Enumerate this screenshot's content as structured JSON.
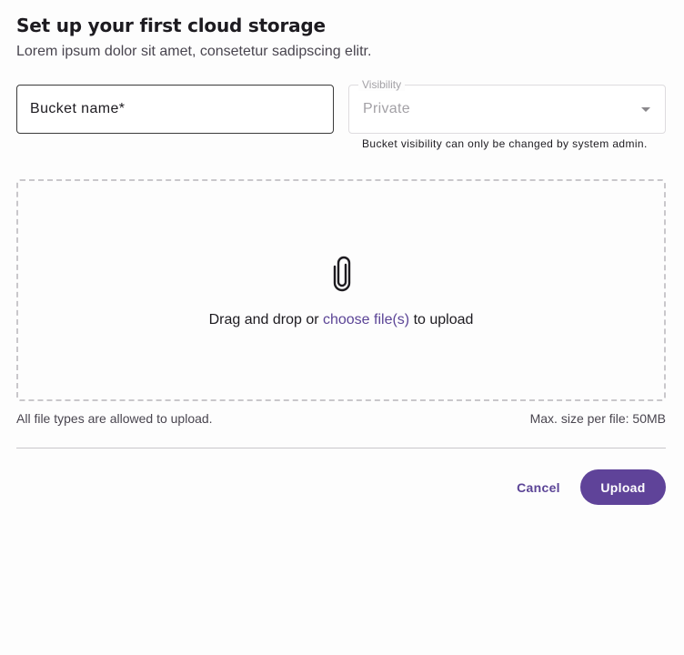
{
  "header": {
    "title": "Set up your first cloud storage",
    "subtitle": "Lorem ipsum dolor sit amet, consetetur sadipscing elitr."
  },
  "bucket_field": {
    "placeholder": "Bucket name*",
    "value": ""
  },
  "visibility": {
    "label": "Visibility",
    "selected": "Private",
    "helper": "Bucket visibility can only be changed by system admin.",
    "icon": "dropdown-arrow-icon"
  },
  "dropzone": {
    "icon": "paperclip-icon",
    "text_before": "Drag and drop or ",
    "link_text": "choose file(s)",
    "text_after": " to upload",
    "hint_left": "All file types are allowed to upload.",
    "hint_right": "Max. size per file: 50MB"
  },
  "actions": {
    "cancel_label": "Cancel",
    "upload_label": "Upload"
  },
  "colors": {
    "accent": "#5f4399",
    "link": "#5b4496",
    "text": "#1d1b20",
    "muted": "#49454f",
    "disabled": "#a3a1a6",
    "border_dashed": "#c9c7cb"
  }
}
